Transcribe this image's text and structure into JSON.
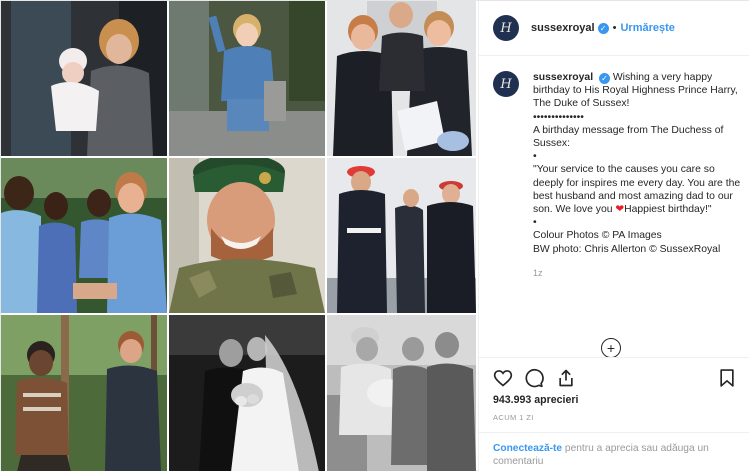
{
  "post": {
    "author": {
      "username": "sussexroyal",
      "avatar_monogram": "H",
      "verified_mark": "✓",
      "follow_label": "Urmărește"
    },
    "caption": {
      "username": "sussexroyal",
      "lines": [
        "Wishing a very happy birthday to His Royal Highness Prince Harry, The Duke of Sussex!",
        "••••••••••••••",
        "A birthday message from The Duchess of Sussex:",
        "•",
        "\"Your service to the causes you care so deeply for inspires me every day. You are the best husband and most amazing dad to our son. We love you",
        "Happiest birthday!\"",
        "•",
        "Colour Photos © PA Images",
        "BW photo: Chris Allerton © SussexRoyal"
      ],
      "heart_glyph": "❤",
      "time": "1z"
    },
    "load_more_glyph": "+",
    "likes_text": "943.993 aprecieri",
    "posted_ago": "ACUM 1 ZI",
    "login_prompt": {
      "link": "Conectează-te",
      "rest": " pentru a aprecia sau adăuga un comentariu"
    },
    "icons": {
      "like": "heart-outline-icon",
      "comment": "comment-bubble-icon",
      "share": "share-icon",
      "save": "bookmark-icon"
    },
    "colors": {
      "link_blue": "#3897f0",
      "verified_blue": "#3897f0",
      "avatar_navy": "#1f3050",
      "heart_red": "#ed1c24"
    }
  }
}
